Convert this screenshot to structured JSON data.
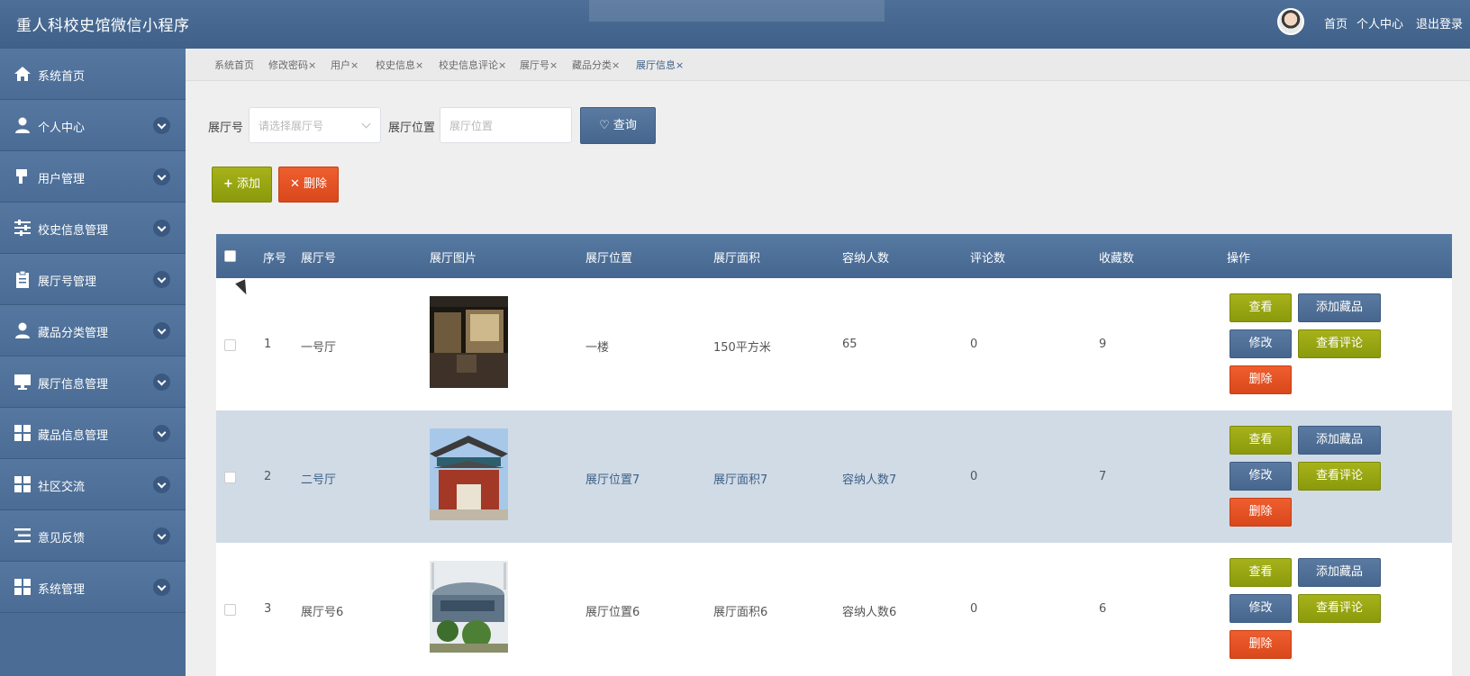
{
  "header": {
    "title": "重人科校史馆微信小程序",
    "nav": {
      "home": "首页",
      "profile": "个人中心",
      "logout": "退出登录"
    }
  },
  "sidebar": {
    "items": [
      {
        "label": "系统首页",
        "icon": "home-icon"
      },
      {
        "label": "个人中心",
        "icon": "user-icon"
      },
      {
        "label": "用户管理",
        "icon": "brush-icon"
      },
      {
        "label": "校史信息管理",
        "icon": "sliders-icon"
      },
      {
        "label": "展厅号管理",
        "icon": "clipboard-icon"
      },
      {
        "label": "藏品分类管理",
        "icon": "user-icon"
      },
      {
        "label": "展厅信息管理",
        "icon": "monitor-icon"
      },
      {
        "label": "藏品信息管理",
        "icon": "grid-icon"
      },
      {
        "label": "社区交流",
        "icon": "grid-icon"
      },
      {
        "label": "意见反馈",
        "icon": "list-icon"
      },
      {
        "label": "系统管理",
        "icon": "grid-icon"
      }
    ]
  },
  "tabs": [
    {
      "label": "系统首页"
    },
    {
      "label": "修改密码×"
    },
    {
      "label": "用户×"
    },
    {
      "label": "校史信息×"
    },
    {
      "label": "校史信息评论×"
    },
    {
      "label": "展厅号×"
    },
    {
      "label": "藏品分类×"
    },
    {
      "label": "展厅信息×"
    }
  ],
  "search": {
    "hall_label": "展厅号",
    "hall_placeholder": "请选择展厅号",
    "location_label": "展厅位置",
    "location_placeholder": "展厅位置",
    "query_button": "查询"
  },
  "toolbar": {
    "add": "添加",
    "delete": "删除"
  },
  "table": {
    "headers": [
      "序号",
      "展厅号",
      "展厅图片",
      "展厅位置",
      "展厅面积",
      "容纳人数",
      "评论数",
      "收藏数",
      "操作"
    ],
    "rows": [
      {
        "no": "1",
        "hall": "一号厅",
        "location": "一楼",
        "area": "150平方米",
        "capacity": "65",
        "comments": "0",
        "favorites": "9"
      },
      {
        "no": "2",
        "hall": "二号厅",
        "location": "展厅位置7",
        "area": "展厅面积7",
        "capacity": "容纳人数7",
        "comments": "0",
        "favorites": "7"
      },
      {
        "no": "3",
        "hall": "展厅号6",
        "location": "展厅位置6",
        "area": "展厅面积6",
        "capacity": "容纳人数6",
        "comments": "0",
        "favorites": "6"
      }
    ],
    "actions": {
      "view": "查看",
      "add_item": "添加藏品",
      "edit": "修改",
      "view_comments": "查看评论",
      "delete": "删除"
    }
  },
  "colors": {
    "header_bg": "#44668f",
    "sidebar_bg": "#4b6d95",
    "btn_green": "#95a212",
    "btn_blue": "#4d6e96",
    "btn_red": "#e4521f",
    "row_alt": "#d0dbe5"
  }
}
